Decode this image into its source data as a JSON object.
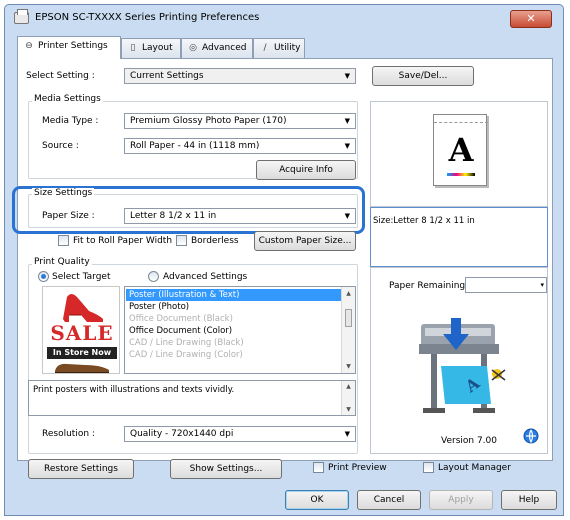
{
  "window": {
    "title": "EPSON SC-TXXXX Series Printing Preferences",
    "close_glyph": "✕"
  },
  "tabs": [
    {
      "label": "Printer Settings",
      "icon": "⊖"
    },
    {
      "label": "Layout",
      "icon": "▯"
    },
    {
      "label": "Advanced",
      "icon": "◎"
    },
    {
      "label": "Utility",
      "icon": "∕"
    }
  ],
  "select_setting": {
    "label": "Select Setting :",
    "value": "Current Settings",
    "save_del": "Save/Del..."
  },
  "media": {
    "group_title": "Media Settings",
    "type_label": "Media Type :",
    "type_value": "Premium Glossy Photo Paper (170)",
    "source_label": "Source :",
    "source_value": "Roll Paper - 44 in (1118 mm)",
    "acquire_info": "Acquire Info"
  },
  "size": {
    "group_title": "Size Settings",
    "paper_size_label": "Paper Size :",
    "paper_size_value": "Letter 8 1/2 x 11 in",
    "fit_roll": "Fit to Roll Paper Width",
    "borderless": "Borderless",
    "custom_size": "Custom Paper Size..."
  },
  "print_quality": {
    "group_title": "Print Quality",
    "select_target": "Select Target",
    "advanced_settings": "Advanced Settings",
    "targets": [
      {
        "label": "Poster (Illustration & Text)",
        "state": "selected"
      },
      {
        "label": "Poster (Photo)",
        "state": "normal"
      },
      {
        "label": "Office Document (Black)",
        "state": "disabled"
      },
      {
        "label": "Office Document (Color)",
        "state": "normal"
      },
      {
        "label": "CAD / Line Drawing (Black)",
        "state": "disabled"
      },
      {
        "label": "CAD / Line Drawing (Color)",
        "state": "disabled"
      }
    ],
    "description": "Print posters with illustrations and texts vividly.",
    "resolution_label": "Resolution :",
    "resolution_value": "Quality - 720x1440 dpi",
    "sale_text": "SALE",
    "store_text": "In Store Now"
  },
  "preview": {
    "letter": "A",
    "size_text": "Size:Letter 8 1/2 x 11 in",
    "paper_remaining_label": "Paper Remaining:",
    "version": "Version 7.00"
  },
  "bottom": {
    "restore": "Restore Settings",
    "show_settings": "Show Settings...",
    "print_preview": "Print Preview",
    "layout_manager": "Layout Manager"
  },
  "dialog": {
    "ok": "OK",
    "cancel": "Cancel",
    "apply": "Apply",
    "help": "Help"
  },
  "colors": {
    "highlight": "#2b73d2",
    "selection": "#3399ff",
    "close_red": "#c74b33",
    "sale_red": "#d62828"
  }
}
